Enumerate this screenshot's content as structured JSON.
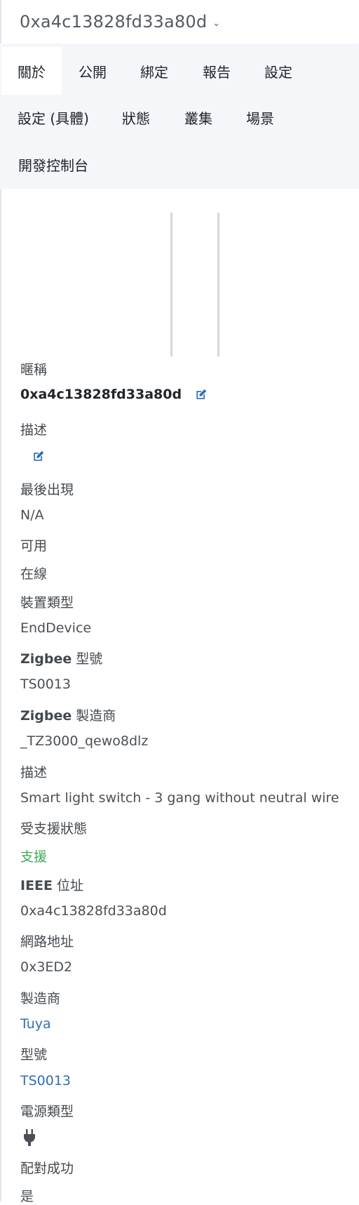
{
  "header": {
    "device_name": "0xa4c13828fd33a80d"
  },
  "tabs": [
    {
      "label": "關於"
    },
    {
      "label": "公開"
    },
    {
      "label": "綁定"
    },
    {
      "label": "報告"
    },
    {
      "label": "設定"
    },
    {
      "label": "設定 (具體)"
    },
    {
      "label": "狀態"
    },
    {
      "label": "叢集"
    },
    {
      "label": "場景"
    },
    {
      "label": "開發控制台"
    }
  ],
  "fields": {
    "nickname": {
      "label": "暱稱",
      "value": "0xa4c13828fd33a80d"
    },
    "description_edit": {
      "label": "描述"
    },
    "last_seen": {
      "label": "最後出現",
      "value": "N/A"
    },
    "availability": {
      "label": "可用",
      "value": "在線"
    },
    "device_type": {
      "label": "裝置類型",
      "value": "EndDevice"
    },
    "zigbee_model": {
      "label_bold": "Zigbee",
      "label": " 型號",
      "value": "TS0013"
    },
    "zigbee_manufacturer": {
      "label_bold": "Zigbee",
      "label": " 製造商",
      "value": "_TZ3000_qewo8dlz"
    },
    "description": {
      "label": "描述",
      "value": "Smart light switch - 3 gang without neutral wire"
    },
    "support_status": {
      "label": "受支援狀態",
      "value": "支援"
    },
    "ieee_address": {
      "label_bold": "IEEE",
      "label": " 位址",
      "value": "0xa4c13828fd33a80d"
    },
    "network_address": {
      "label": "網路地址",
      "value": "0x3ED2"
    },
    "manufacturer": {
      "label": "製造商",
      "value": "Tuya"
    },
    "model": {
      "label": "型號",
      "value": "TS0013"
    },
    "power_source": {
      "label": "電源類型",
      "icon": "plug-icon"
    },
    "interview_completed": {
      "label": "配對成功",
      "value": "是"
    }
  },
  "colors": {
    "tab_bar_bg": "#f4f6fa",
    "accent_blue": "#2f6fb6",
    "supported_green": "#3faa55"
  }
}
